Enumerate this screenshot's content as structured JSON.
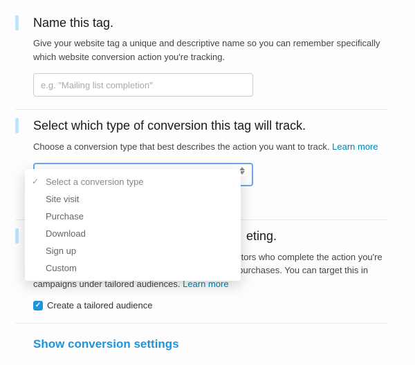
{
  "sections": {
    "name_tag": {
      "title": "Name this tag.",
      "desc": "Give your website tag a unique and descriptive name so you can remember specifically which website conversion action you're tracking.",
      "placeholder": "e.g. \"Mailing list completion\""
    },
    "conversion_type": {
      "title": "Select which type of conversion this tag will track.",
      "desc": "Choose a conversion type that best describes the action you want to track. ",
      "learn_more": "Learn more",
      "dropdown": {
        "placeholder": "Select a conversion type",
        "options": [
          "Site visit",
          "Purchase",
          "Download",
          "Sign up",
          "Custom"
        ]
      }
    },
    "tailored_audience": {
      "title_suffix": "eting.",
      "desc_prefix": "Create a tailored audience composed of website visitors who complete the action you're tracking — for example, website visitors who made purchases. You can target this in campaigns under tailored audiences. ",
      "learn_more": "Learn more",
      "checkbox": {
        "checked": true,
        "label": "Create a tailored audience"
      }
    }
  },
  "show_settings": "Show conversion settings"
}
